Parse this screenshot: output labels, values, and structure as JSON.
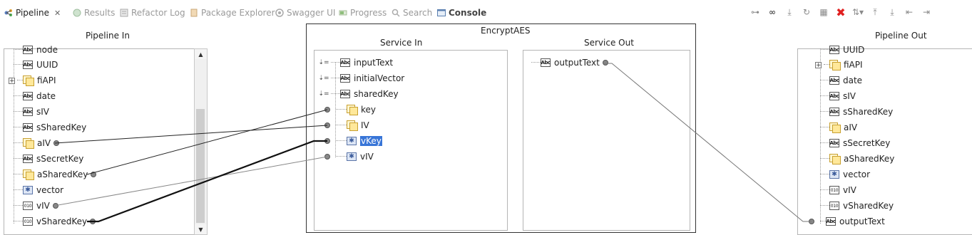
{
  "tabs": [
    {
      "label": "Pipeline",
      "active": true
    },
    {
      "label": "Results"
    },
    {
      "label": "Refactor Log"
    },
    {
      "label": "Package Explorer"
    },
    {
      "label": "Swagger UI"
    },
    {
      "label": "Progress"
    },
    {
      "label": "Search"
    },
    {
      "label": "Console"
    }
  ],
  "toolbar_icons": [
    "link-icon",
    "infinity-icon",
    "step-into-icon",
    "refresh-icon",
    "map-icon",
    "delete-icon",
    "transform-icon",
    "move-up-icon",
    "move-down-icon",
    "move-left-icon",
    "move-right-icon"
  ],
  "pipeline_in": {
    "title": "Pipeline In",
    "items": [
      {
        "label": "node",
        "icon": "abc"
      },
      {
        "label": "UUID",
        "icon": "abc"
      },
      {
        "label": "fiAPI",
        "icon": "doc",
        "expandable": true
      },
      {
        "label": "date",
        "icon": "abc"
      },
      {
        "label": "sIV",
        "icon": "abc"
      },
      {
        "label": "sSharedKey",
        "icon": "abc"
      },
      {
        "label": "aIV",
        "icon": "doc",
        "port": true
      },
      {
        "label": "sSecretKey",
        "icon": "abc"
      },
      {
        "label": "aSharedKey",
        "icon": "doc",
        "port": true
      },
      {
        "label": "vector",
        "icon": "obj"
      },
      {
        "label": "vIV",
        "icon": "010",
        "port": true
      },
      {
        "label": "vSharedKey",
        "icon": "010",
        "port": true
      }
    ]
  },
  "service": {
    "title": "EncryptAES",
    "service_in": {
      "title": "Service In",
      "items": [
        {
          "label": "inputText",
          "icon": "abc",
          "mapped": true
        },
        {
          "label": "initialVector",
          "icon": "abc",
          "mapped": true
        },
        {
          "label": "sharedKey",
          "icon": "abc",
          "mapped": true
        },
        {
          "label": "key",
          "icon": "doc",
          "port": true
        },
        {
          "label": "IV",
          "icon": "doc",
          "port": true
        },
        {
          "label": "vKey",
          "icon": "obj",
          "port": true,
          "selected": true
        },
        {
          "label": "vIV",
          "icon": "obj",
          "port": true
        }
      ]
    },
    "service_out": {
      "title": "Service Out",
      "items": [
        {
          "label": "outputText",
          "icon": "abc",
          "port": true
        }
      ]
    }
  },
  "pipeline_out": {
    "title": "Pipeline Out",
    "items": [
      {
        "label": "UUID",
        "icon": "abc"
      },
      {
        "label": "fiAPI",
        "icon": "doc",
        "expandable": true
      },
      {
        "label": "date",
        "icon": "abc"
      },
      {
        "label": "sIV",
        "icon": "abc"
      },
      {
        "label": "sSharedKey",
        "icon": "abc"
      },
      {
        "label": "aIV",
        "icon": "doc"
      },
      {
        "label": "sSecretKey",
        "icon": "abc"
      },
      {
        "label": "aSharedKey",
        "icon": "doc"
      },
      {
        "label": "vector",
        "icon": "obj"
      },
      {
        "label": "vIV",
        "icon": "010"
      },
      {
        "label": "vSharedKey",
        "icon": "010"
      },
      {
        "label": "outputText",
        "icon": "abc",
        "port": true
      }
    ]
  },
  "mappings": [
    {
      "from": "pipeline_in.aIV",
      "to": "service_in.IV"
    },
    {
      "from": "pipeline_in.aSharedKey",
      "to": "service_in.key"
    },
    {
      "from": "pipeline_in.vIV",
      "to": "service_in.vIV"
    },
    {
      "from": "pipeline_in.vSharedKey",
      "to": "service_in.vKey",
      "selected": true
    },
    {
      "from": "service_out.outputText",
      "to": "pipeline_out.outputText"
    }
  ],
  "colors": {
    "selection": "#3875d7",
    "link": "#333333",
    "link_light": "#888888",
    "delete": "#e02020"
  }
}
